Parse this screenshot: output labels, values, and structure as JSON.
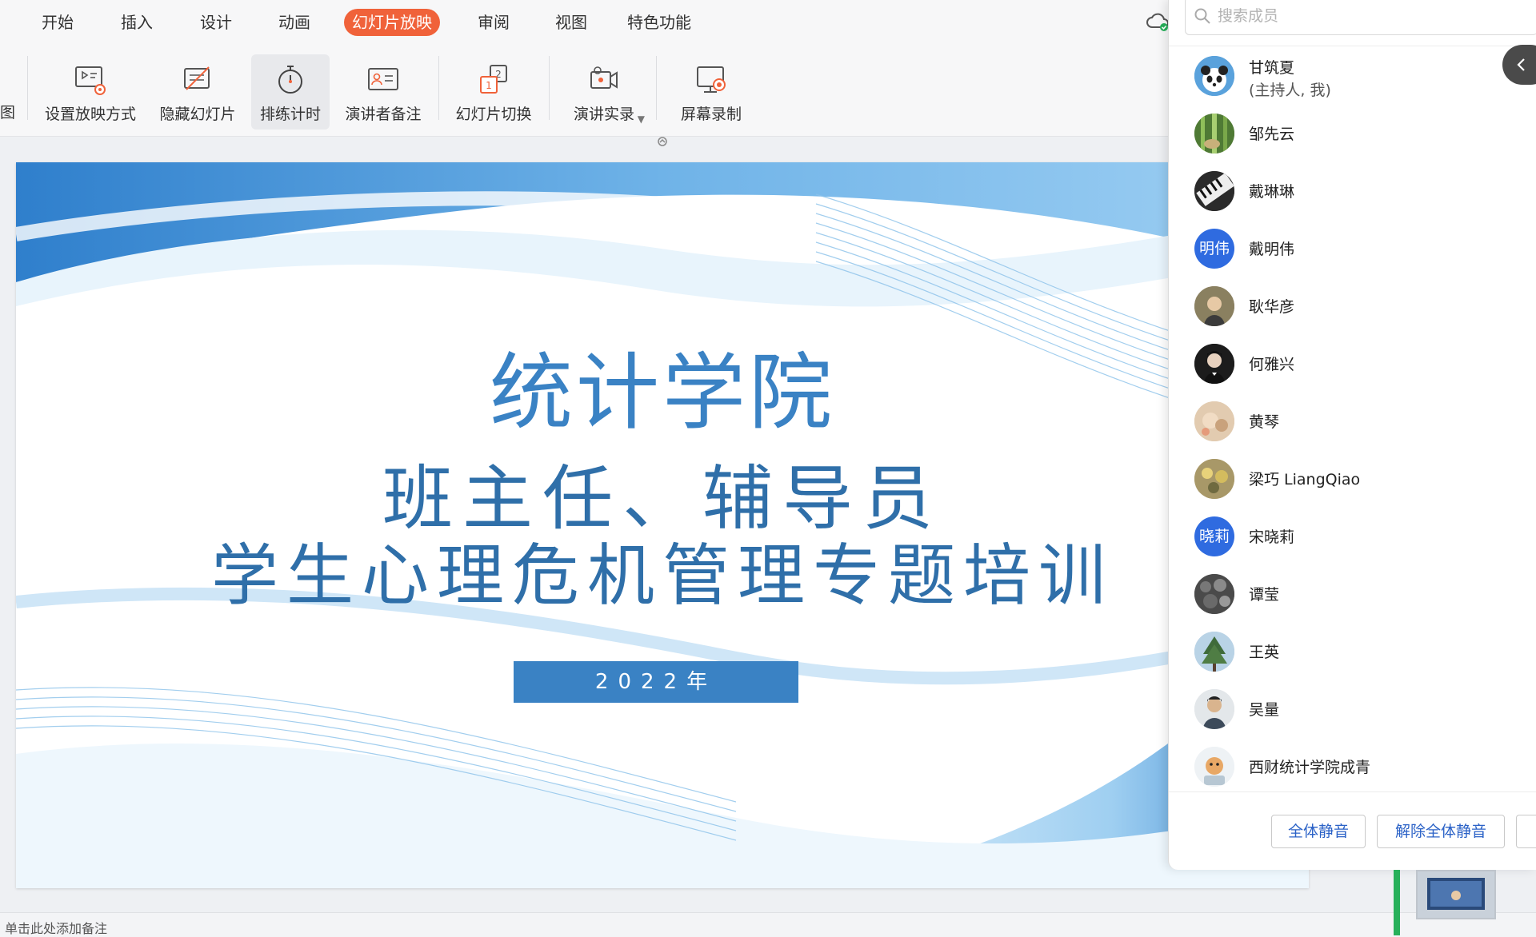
{
  "menu": {
    "items": [
      "开始",
      "插入",
      "设计",
      "动画",
      "幻灯片放映",
      "审阅",
      "视图",
      "特色功能"
    ],
    "active": "幻灯片放映"
  },
  "ribbon": {
    "left_cut_label": "图",
    "buttons": [
      "设置放映方式",
      "隐藏幻灯片",
      "排练计时",
      "演讲者备注",
      "幻灯片切换",
      "演讲实录",
      "屏幕录制"
    ]
  },
  "slide": {
    "title": "统计学院",
    "subtitle_line1": "班主任、辅导员",
    "subtitle_line2": "学生心理危机管理专题培训",
    "year": "2022年"
  },
  "notes": {
    "placeholder": "单击此处添加备注"
  },
  "panel": {
    "search_placeholder": "搜索成员",
    "members": [
      {
        "name": "甘筑夏",
        "role": "(主持人, 我)",
        "avatar": "panda"
      },
      {
        "name": "邹先云",
        "role": "",
        "avatar": "bamboo"
      },
      {
        "name": "戴琳琳",
        "role": "",
        "avatar": "piano"
      },
      {
        "name": "戴明伟",
        "role": "",
        "avatar": "initials",
        "initials": "明伟"
      },
      {
        "name": "耿华彦",
        "role": "",
        "avatar": "portrait"
      },
      {
        "name": "何雅兴",
        "role": "",
        "avatar": "portrait-dark"
      },
      {
        "name": "黄琴",
        "role": "",
        "avatar": "warm"
      },
      {
        "name": "梁巧 LiangQiao",
        "role": "",
        "avatar": "flowers"
      },
      {
        "name": "宋晓莉",
        "role": "",
        "avatar": "initials",
        "initials": "晓莉"
      },
      {
        "name": "谭莹",
        "role": "",
        "avatar": "stones"
      },
      {
        "name": "王英",
        "role": "",
        "avatar": "tree"
      },
      {
        "name": "吴量",
        "role": "",
        "avatar": "person"
      },
      {
        "name": "西财统计学院成青",
        "role": "",
        "avatar": "cartoon"
      }
    ],
    "buttons": {
      "mute_all": "全体静音",
      "unmute_all": "解除全体静音"
    }
  },
  "colors": {
    "accent": "#f0623a",
    "slide_blue": "#3a82c4",
    "initials_blue": "#2f6be0",
    "link_blue": "#2b62c7"
  }
}
